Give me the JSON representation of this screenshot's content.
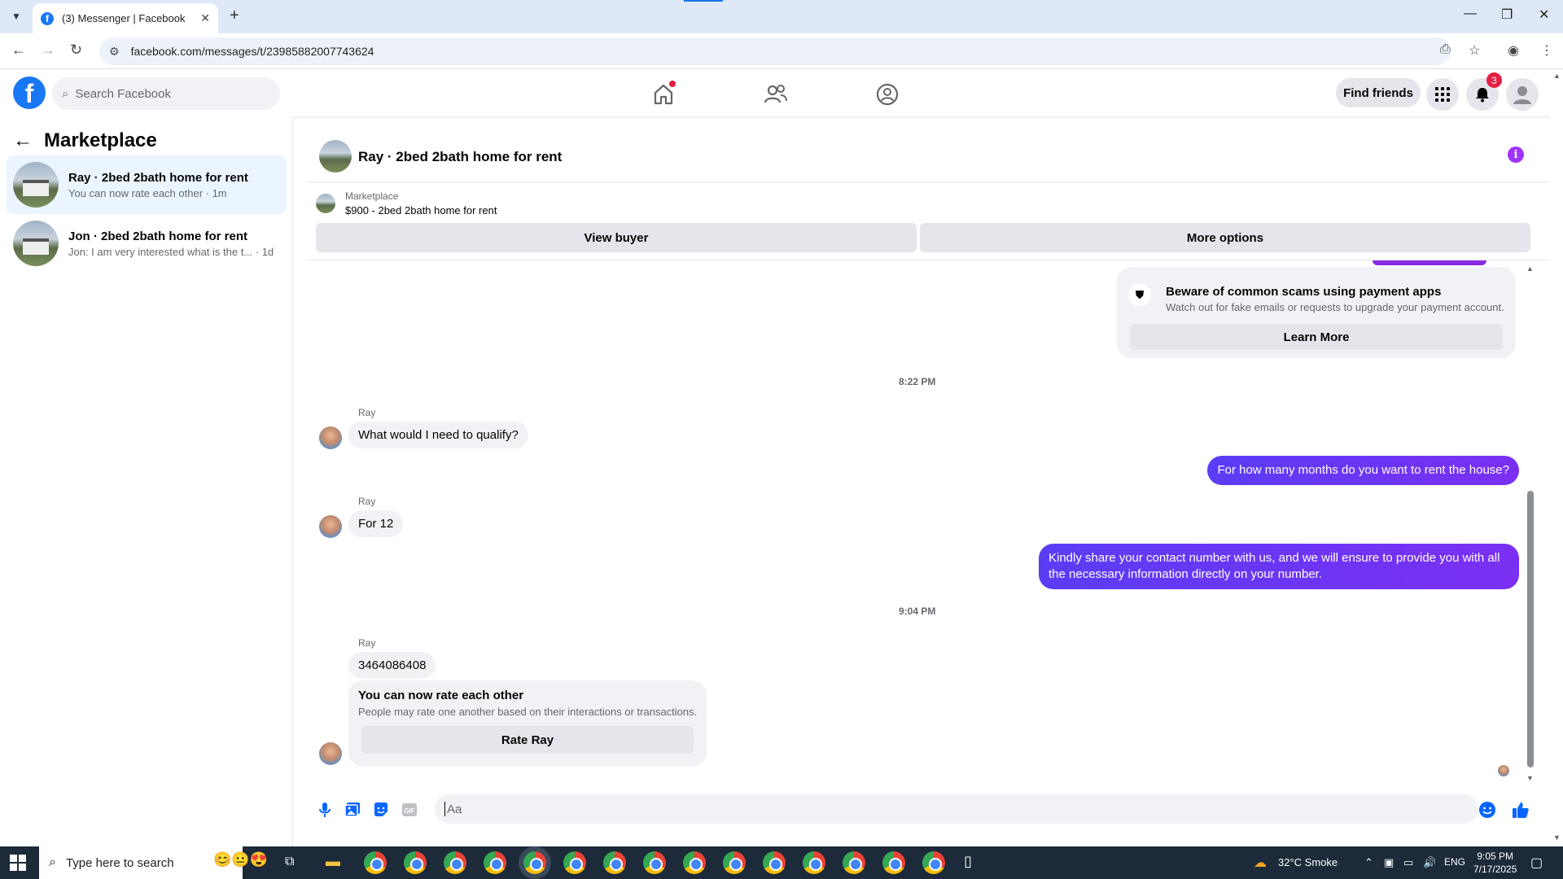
{
  "browser": {
    "tab_title": "(3) Messenger | Facebook",
    "tab_close": "✕",
    "new_tab": "+",
    "url": "facebook.com/messages/t/23985882007743624",
    "win_min": "—",
    "win_max": "❐",
    "win_close": "✕"
  },
  "fbnav": {
    "logo": "f",
    "search_placeholder": "Search Facebook",
    "find_friends": "Find friends",
    "notifications_count": "3"
  },
  "left_panel": {
    "title": "Marketplace",
    "conversations": [
      {
        "title": "Ray · 2bed 2bath home for rent",
        "subtitle": "You can now rate each other · 1m"
      },
      {
        "title": "Jon · 2bed 2bath home for rent",
        "subtitle": "Jon: I am very interested what is the t...  · 1d"
      }
    ]
  },
  "chat": {
    "header_name": "Ray · 2bed 2bath home for rent",
    "info_icon": "i",
    "marketplace_label": "Marketplace",
    "listing_price": "$900 - 2bed 2bath home for rent",
    "view_buyer": "View buyer",
    "more_options": "More options",
    "scam_notice": {
      "title": "Beware of common scams using payment apps",
      "subtitle": "Watch out for fake emails or requests to upgrade your payment account.",
      "button": "Learn More"
    },
    "timestamp_1": "8:22 PM",
    "timestamp_2": "9:04 PM",
    "sender_name": "Ray",
    "messages": [
      {
        "from": "Ray",
        "text": "What would I need to qualify?"
      },
      {
        "from": "me",
        "text": "For how many months do you want to rent the house?"
      },
      {
        "from": "Ray",
        "text": "For 12"
      },
      {
        "from": "me",
        "text": "Kindly share your contact number with us, and we will ensure to provide you with all the necessary information directly on your number."
      },
      {
        "from": "Ray",
        "text": "3464086408"
      }
    ],
    "rate_card": {
      "title": "You can now rate each other",
      "subtitle": "People may rate one another based on their interactions or transactions.",
      "button": "Rate Ray"
    },
    "composer_placeholder": "Aa"
  },
  "taskbar": {
    "search_placeholder": "Type here to search",
    "weather": "32°C  Smoke",
    "language": "ENG",
    "time": "9:05 PM",
    "date": "7/17/2025"
  },
  "colors": {
    "fb_blue": "#1877f2",
    "outgoing_bubble": "#6a35f3",
    "info_purple": "#a033ff",
    "notification_red": "#e41e3f"
  }
}
